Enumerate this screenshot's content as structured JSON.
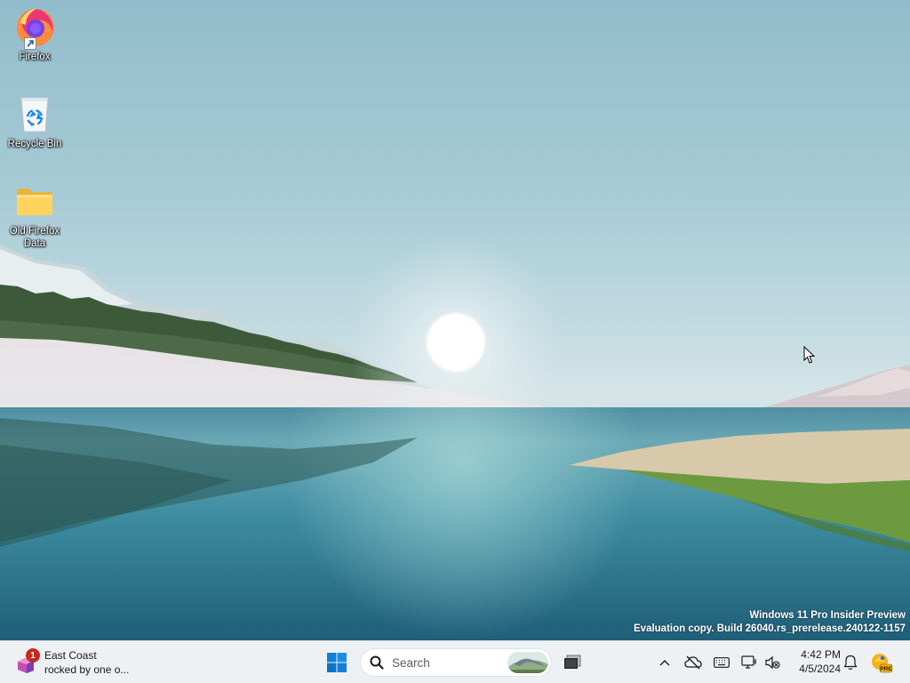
{
  "desktop": {
    "icons": [
      {
        "label": "Firefox"
      },
      {
        "label": "Recycle Bin"
      },
      {
        "label": "Old Firefox Data"
      }
    ]
  },
  "watermark": {
    "line1": "Windows 11 Pro Insider Preview",
    "line2": "Evaluation copy. Build 26040.rs_prerelease.240122-1157"
  },
  "taskbar": {
    "widget": {
      "badge": "1",
      "line1": "East Coast",
      "line2": "rocked by one o..."
    },
    "search": {
      "placeholder": "Search"
    },
    "clock": {
      "time": "4:42 PM",
      "date": "4/5/2024"
    },
    "tray_icons": [
      "chevron-up-icon",
      "onedrive-paused-icon",
      "keyboard-icon",
      "display-icon",
      "volume-muted-icon",
      "bell-icon",
      "dev-pre-icon"
    ],
    "dev_badge": "PRE"
  },
  "colors": {
    "taskbar_bg": "#eef1f4",
    "start_blue": "#0078d4",
    "notification_badge": "#c42b1c"
  }
}
